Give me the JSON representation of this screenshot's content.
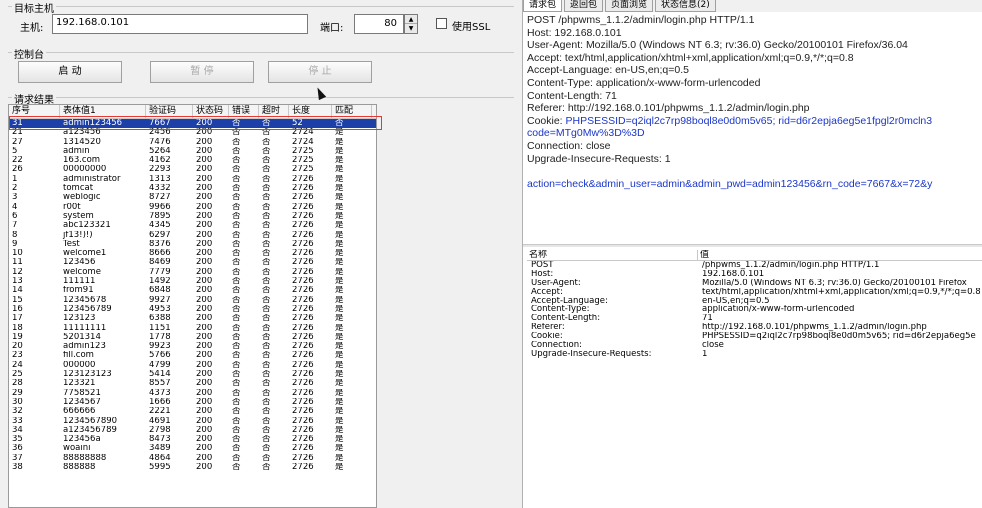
{
  "target": {
    "group_title": "目标主机",
    "host_label": "主机:",
    "host_value": "192.168.0.101",
    "port_label": "端口:",
    "port_value": "80",
    "ssl_label": "使用SSL"
  },
  "console": {
    "group_title": "控制台",
    "start_label": "启 动",
    "pause_label": "暂 停",
    "stop_label": "停 止"
  },
  "results": {
    "group_title": "请求结果",
    "columns": [
      "序号",
      "表体值1",
      "验证码",
      "状态码",
      "错误",
      "超时",
      "长度",
      "匹配"
    ],
    "rows": [
      [
        "31",
        "admin123456",
        "7667",
        "200",
        "否",
        "否",
        "52",
        "否"
      ],
      [
        "21",
        "a123456",
        "2456",
        "200",
        "否",
        "否",
        "2724",
        "是"
      ],
      [
        "27",
        "1314520",
        "7476",
        "200",
        "否",
        "否",
        "2724",
        "是"
      ],
      [
        "5",
        "admin",
        "5264",
        "200",
        "否",
        "否",
        "2725",
        "是"
      ],
      [
        "22",
        "163.com",
        "4162",
        "200",
        "否",
        "否",
        "2725",
        "是"
      ],
      [
        "26",
        "00000000",
        "2293",
        "200",
        "否",
        "否",
        "2725",
        "是"
      ],
      [
        "1",
        "administrator",
        "1313",
        "200",
        "否",
        "否",
        "2726",
        "是"
      ],
      [
        "2",
        "tomcat",
        "4332",
        "200",
        "否",
        "否",
        "2726",
        "是"
      ],
      [
        "3",
        "weblogic",
        "8727",
        "200",
        "否",
        "否",
        "2726",
        "是"
      ],
      [
        "4",
        "r00t",
        "9966",
        "200",
        "否",
        "否",
        "2726",
        "是"
      ],
      [
        "6",
        "system",
        "7895",
        "200",
        "否",
        "否",
        "2726",
        "是"
      ],
      [
        "7",
        "abc123321",
        "4345",
        "200",
        "否",
        "否",
        "2726",
        "是"
      ],
      [
        "8",
        "jf13!)!)",
        "6297",
        "200",
        "否",
        "否",
        "2726",
        "是"
      ],
      [
        "9",
        "Test",
        "8376",
        "200",
        "否",
        "否",
        "2726",
        "是"
      ],
      [
        "10",
        "welcome1",
        "8666",
        "200",
        "否",
        "否",
        "2726",
        "是"
      ],
      [
        "11",
        "123456",
        "8469",
        "200",
        "否",
        "否",
        "2726",
        "是"
      ],
      [
        "12",
        "welcome",
        "7779",
        "200",
        "否",
        "否",
        "2726",
        "是"
      ],
      [
        "13",
        "111111",
        "1492",
        "200",
        "否",
        "否",
        "2726",
        "是"
      ],
      [
        "14",
        "from91",
        "6848",
        "200",
        "否",
        "否",
        "2726",
        "是"
      ],
      [
        "15",
        "12345678",
        "9927",
        "200",
        "否",
        "否",
        "2726",
        "是"
      ],
      [
        "16",
        "123456789",
        "4953",
        "200",
        "否",
        "否",
        "2726",
        "是"
      ],
      [
        "17",
        "123123",
        "6388",
        "200",
        "否",
        "否",
        "2726",
        "是"
      ],
      [
        "18",
        "11111111",
        "1151",
        "200",
        "否",
        "否",
        "2726",
        "是"
      ],
      [
        "19",
        "5201314",
        "1778",
        "200",
        "否",
        "否",
        "2726",
        "是"
      ],
      [
        "20",
        "admin123",
        "9923",
        "200",
        "否",
        "否",
        "2726",
        "是"
      ],
      [
        "23",
        "fill.com",
        "5766",
        "200",
        "否",
        "否",
        "2726",
        "是"
      ],
      [
        "24",
        "000000",
        "4799",
        "200",
        "否",
        "否",
        "2726",
        "是"
      ],
      [
        "25",
        "123123123",
        "5414",
        "200",
        "否",
        "否",
        "2726",
        "是"
      ],
      [
        "28",
        "123321",
        "8557",
        "200",
        "否",
        "否",
        "2726",
        "是"
      ],
      [
        "29",
        "7758521",
        "4373",
        "200",
        "否",
        "否",
        "2726",
        "是"
      ],
      [
        "30",
        "1234567",
        "1666",
        "200",
        "否",
        "否",
        "2726",
        "是"
      ],
      [
        "32",
        "666666",
        "2221",
        "200",
        "否",
        "否",
        "2726",
        "是"
      ],
      [
        "33",
        "1234567890",
        "4691",
        "200",
        "否",
        "否",
        "2726",
        "是"
      ],
      [
        "34",
        "a123456789",
        "2798",
        "200",
        "否",
        "否",
        "2726",
        "是"
      ],
      [
        "35",
        "123456a",
        "8473",
        "200",
        "否",
        "否",
        "2726",
        "是"
      ],
      [
        "36",
        "woaini",
        "3489",
        "200",
        "否",
        "否",
        "2726",
        "是"
      ],
      [
        "37",
        "88888888",
        "4864",
        "200",
        "否",
        "否",
        "2726",
        "是"
      ],
      [
        "38",
        "888888",
        "5995",
        "200",
        "否",
        "否",
        "2726",
        "是"
      ]
    ]
  },
  "panel": {
    "tabs": [
      "请求包",
      "返回包",
      "页面浏览",
      "状态信息(2)"
    ],
    "request_lines": [
      "POST /phpwms_1.1.2/admin/login.php HTTP/1.1",
      "Host: 192.168.0.101",
      "User-Agent: Mozilla/5.0 (Windows NT 6.3; rv:36.0) Gecko/20100101 Firefox/36.04",
      "Accept: text/html,application/xhtml+xml,application/xml;q=0.9,*/*;q=0.8",
      "Accept-Language: en-US,en;q=0.5",
      "Content-Type: application/x-www-form-urlencoded",
      "Content-Length: 71",
      "Referer: http://192.168.0.101/phpwms_1.1.2/admin/login.php"
    ],
    "cookie_label": "Cookie: ",
    "cookie_value": "PHPSESSID=q2iql2c7rp98boql8e0d0m5v65; rid=d6r2epja6eg5e1fpgl2r0mcln3",
    "cookie_value_cont": "code=MTg0Mw%3D%3D",
    "request_lines_after": [
      "Connection: close",
      "Upgrade-Insecure-Requests: 1"
    ],
    "body": "action=check&admin_user=admin&admin_pwd=admin123456&rn_code=7667&x=72&y",
    "header_columns": [
      "名称",
      "值"
    ],
    "headers": [
      [
        "POST",
        "/phpwms_1.1.2/admin/login.php HTTP/1.1"
      ],
      [
        "Host:",
        "192.168.0.101"
      ],
      [
        "User-Agent:",
        "Mozilla/5.0 (Windows NT 6.3; rv:36.0) Gecko/20100101 Firefox"
      ],
      [
        "Accept:",
        "text/html,application/xhtml+xml,application/xml;q=0.9,*/*;q=0.8"
      ],
      [
        "Accept-Language:",
        "en-US,en;q=0.5"
      ],
      [
        "Content-Type:",
        "application/x-www-form-urlencoded"
      ],
      [
        "Content-Length:",
        "71"
      ],
      [
        "Referer:",
        "http://192.168.0.101/phpwms_1.1.2/admin/login.php"
      ],
      [
        "Cookie:",
        "PHPSESSID=q2iql2c7rp98boql8e0d0m5v65; rid=d6r2epja6eg5e"
      ],
      [
        "Connection:",
        "close"
      ],
      [
        "Upgrade-Insecure-Requests:",
        "1"
      ]
    ]
  },
  "colors": {
    "selected_row": "#1c3fa8",
    "highlight_box": "#e53935",
    "link_blue": "#1a36c9"
  }
}
